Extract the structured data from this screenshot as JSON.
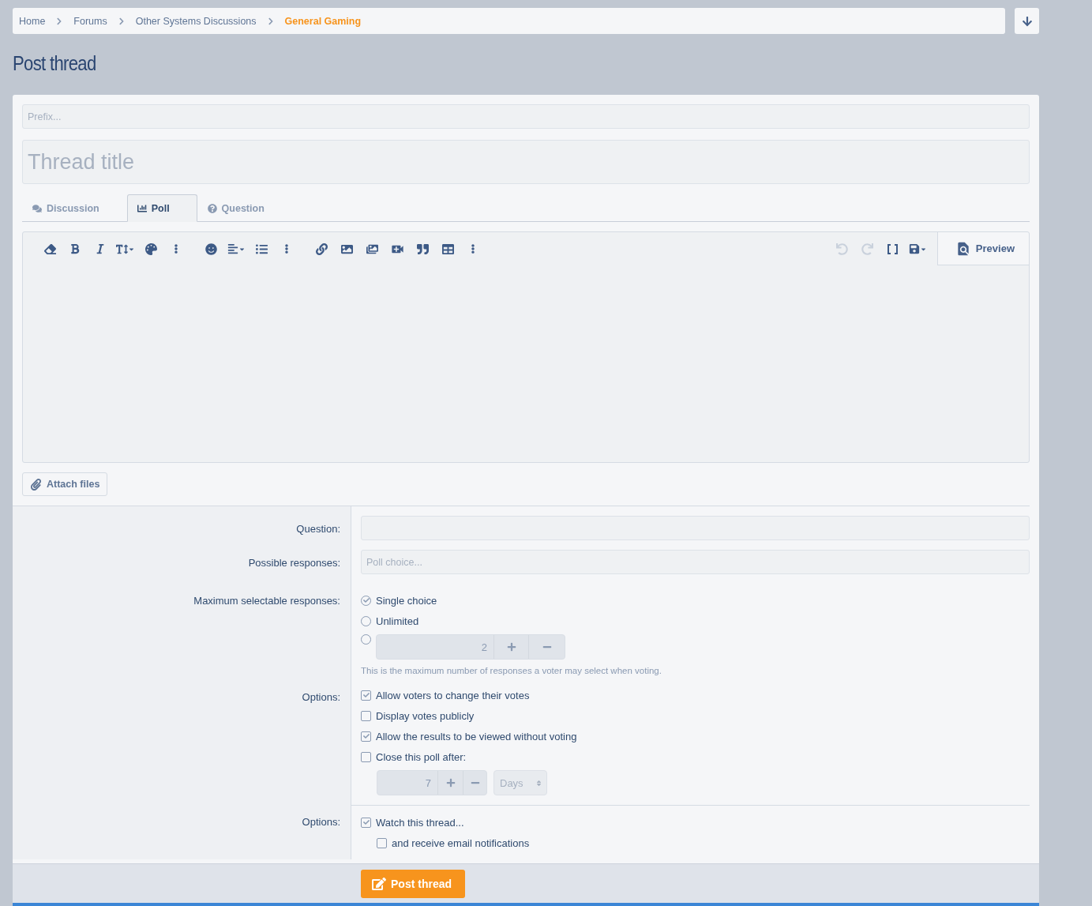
{
  "breadcrumb": [
    {
      "label": "Home",
      "current": false
    },
    {
      "label": "Forums",
      "current": false
    },
    {
      "label": "Other Systems Discussions",
      "current": false
    },
    {
      "label": "General Gaming",
      "current": true
    }
  ],
  "title": "Post thread",
  "prefix": {
    "placeholder": "Prefix..."
  },
  "thread_title": {
    "placeholder": "Thread title"
  },
  "tabs": [
    {
      "kind": "discussion",
      "label": "Discussion",
      "selected": false
    },
    {
      "kind": "poll",
      "label": "Poll",
      "selected": true
    },
    {
      "kind": "question",
      "label": "Question",
      "selected": false
    }
  ],
  "history": [
    {
      "kind": "undo",
      "disabled": true
    },
    {
      "kind": "redo",
      "disabled": true
    }
  ],
  "preview": "Preview",
  "attach": "Attach files",
  "poll": {
    "question_label": "Question:",
    "responses_label": "Possible responses:",
    "responses_placeholder": "Poll choice...",
    "max_label": "Maximum selectable responses:",
    "max_choices": [
      {
        "kind": "radio",
        "label": "Single choice",
        "selected": true
      },
      {
        "kind": "radio",
        "label": "Unlimited",
        "selected": false
      },
      {
        "kind": "number",
        "value": "2",
        "selected": false
      }
    ],
    "max_hint": "This is the maximum number of responses a voter may select when voting.",
    "options_label": "Options:",
    "options": [
      {
        "label": "Allow voters to change their votes",
        "checked": true
      },
      {
        "label": "Display votes publicly",
        "checked": false
      },
      {
        "label": "Allow the results to be viewed without voting",
        "checked": true
      },
      {
        "label": "Close this poll after:",
        "checked": false
      }
    ],
    "close_after": {
      "value": "7",
      "unit": "Days"
    }
  },
  "thread_options": {
    "label": "Options:",
    "items": [
      {
        "label": "Watch this thread...",
        "checked": true,
        "children": [
          {
            "label": "and receive email notifications",
            "checked": false
          }
        ]
      }
    ]
  },
  "submit": "Post thread"
}
